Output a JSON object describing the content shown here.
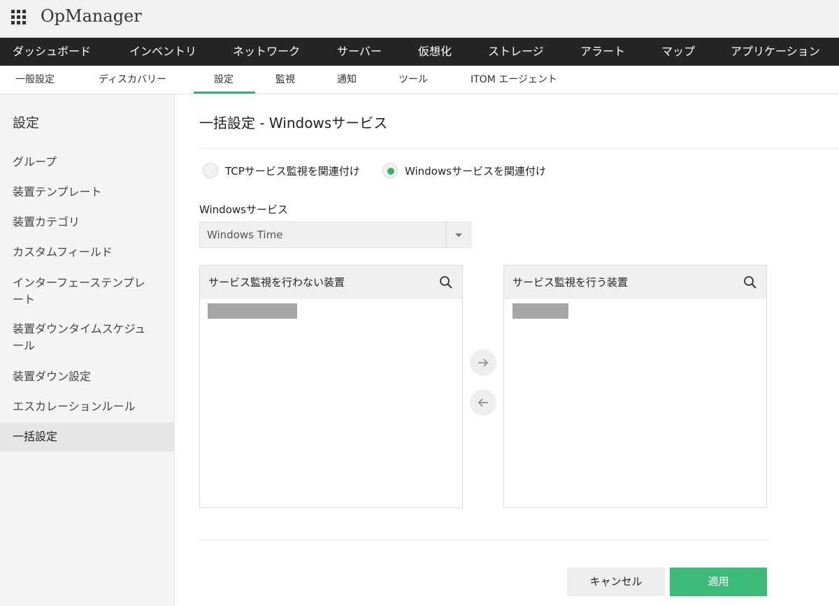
{
  "app": {
    "title": "OpManager"
  },
  "main_nav": [
    "ダッシュボード",
    "インベントリ",
    "ネットワーク",
    "サーバー",
    "仮想化",
    "ストレージ",
    "アラート",
    "マップ",
    "アプリケーション"
  ],
  "sub_nav": {
    "items": [
      "一般設定",
      "ディスカバリー",
      "設定",
      "監視",
      "通知",
      "ツール",
      "ITOM エージェント"
    ],
    "active": "設定"
  },
  "sidebar": {
    "title": "設定",
    "items": [
      "グループ",
      "装置テンプレート",
      "装置カテゴリ",
      "カスタムフィールド",
      "インターフェーステンプレ\nート",
      "装置ダウンタイムスケジュ\nール",
      "装置ダウン設定",
      "エスカレーションルール",
      "一括設定"
    ],
    "active": "一括設定"
  },
  "page": {
    "title": "一括設定 - Windowsサービス"
  },
  "association": {
    "options": [
      "TCPサービス監視を関連付け",
      "Windowsサービスを関連付け"
    ],
    "selected": "Windowsサービスを関連付け"
  },
  "service_select": {
    "label": "Windowsサービス",
    "value": "Windows Time"
  },
  "lists": {
    "not_monitored": {
      "title": "サービス監視を行わない装置"
    },
    "monitored": {
      "title": "サービス監視を行う装置"
    }
  },
  "buttons": {
    "cancel": "キャンセル",
    "apply": "適用"
  },
  "colors": {
    "accent": "#3dae6c",
    "nav_bg": "#252525",
    "apply_bg": "#3dbb7b"
  },
  "icons": {
    "app_menu": "grid-icon",
    "search": "search-icon",
    "move_right": "arrow-right-icon",
    "move_left": "arrow-left-icon"
  }
}
